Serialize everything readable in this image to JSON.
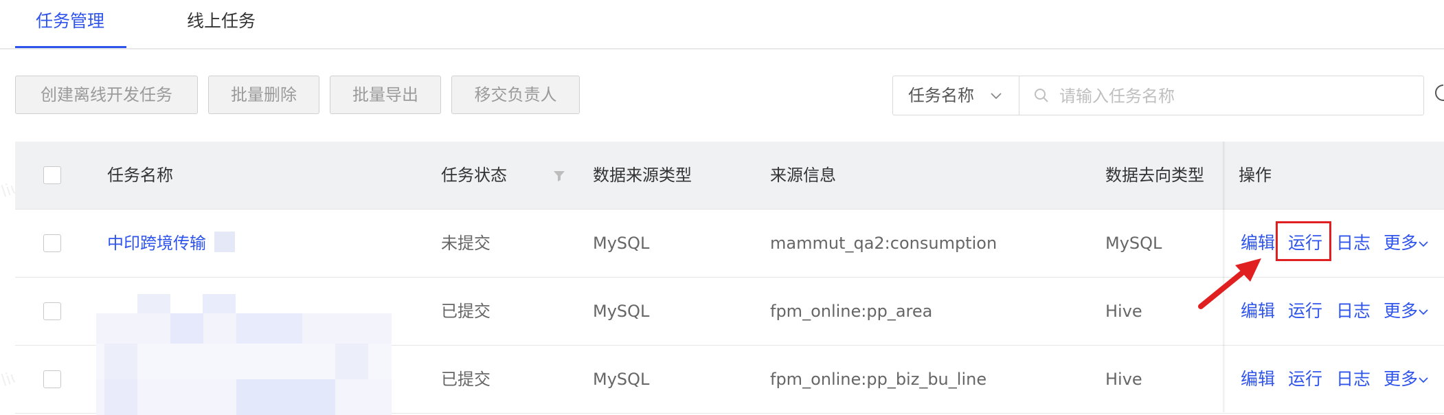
{
  "tabs": [
    {
      "label": "任务管理",
      "active": true
    },
    {
      "label": "线上任务",
      "active": false
    }
  ],
  "toolbar": {
    "create_label": "创建离线开发任务",
    "batch_delete_label": "批量删除",
    "batch_export_label": "批量导出",
    "transfer_owner_label": "移交负责人"
  },
  "search": {
    "field_label": "任务名称",
    "placeholder": "请输入任务名称",
    "value": ""
  },
  "table": {
    "columns": {
      "name": "任务名称",
      "status": "任务状态",
      "source_type": "数据来源类型",
      "source_info": "来源信息",
      "target_type": "数据去向类型",
      "actions": "操作"
    },
    "rows": [
      {
        "name": "中印跨境传输",
        "status": "未提交",
        "source_type": "MySQL",
        "source_info": "mammut_qa2:consumption",
        "target_type": "MySQL"
      },
      {
        "name": "",
        "status": "已提交",
        "source_type": "MySQL",
        "source_info": "fpm_online:pp_area",
        "target_type": "Hive"
      },
      {
        "name": "",
        "status": "已提交",
        "source_type": "MySQL",
        "source_info": "fpm_online:pp_biz_bu_line",
        "target_type": "Hive"
      }
    ],
    "actions": {
      "edit": "编辑",
      "run": "运行",
      "log": "日志",
      "more": "更多"
    }
  },
  "watermark": "liudiqing",
  "colors": {
    "accent": "#2f54eb",
    "highlight": "#e02020",
    "header_bg": "#f0f1f3"
  }
}
